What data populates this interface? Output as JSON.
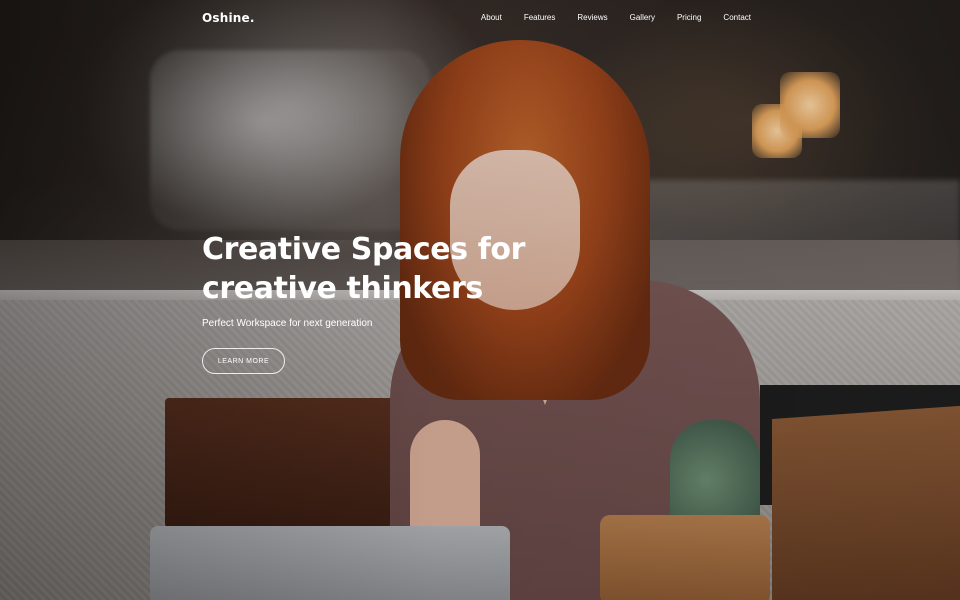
{
  "brand": {
    "logo_text": "Oshine."
  },
  "nav": {
    "items": [
      {
        "label": "About"
      },
      {
        "label": "Features"
      },
      {
        "label": "Reviews"
      },
      {
        "label": "Gallery"
      },
      {
        "label": "Pricing"
      },
      {
        "label": "Contact"
      }
    ]
  },
  "hero": {
    "title_line1": "Creative Spaces for",
    "title_line2": "creative thinkers",
    "subtitle": "Perfect Workspace for next generation",
    "cta_label": "LEARN MORE",
    "image_subject": "woman-smiling-at-laptop-in-cafe"
  },
  "colors": {
    "text": "#ffffff",
    "button_border": "#ffffff"
  }
}
